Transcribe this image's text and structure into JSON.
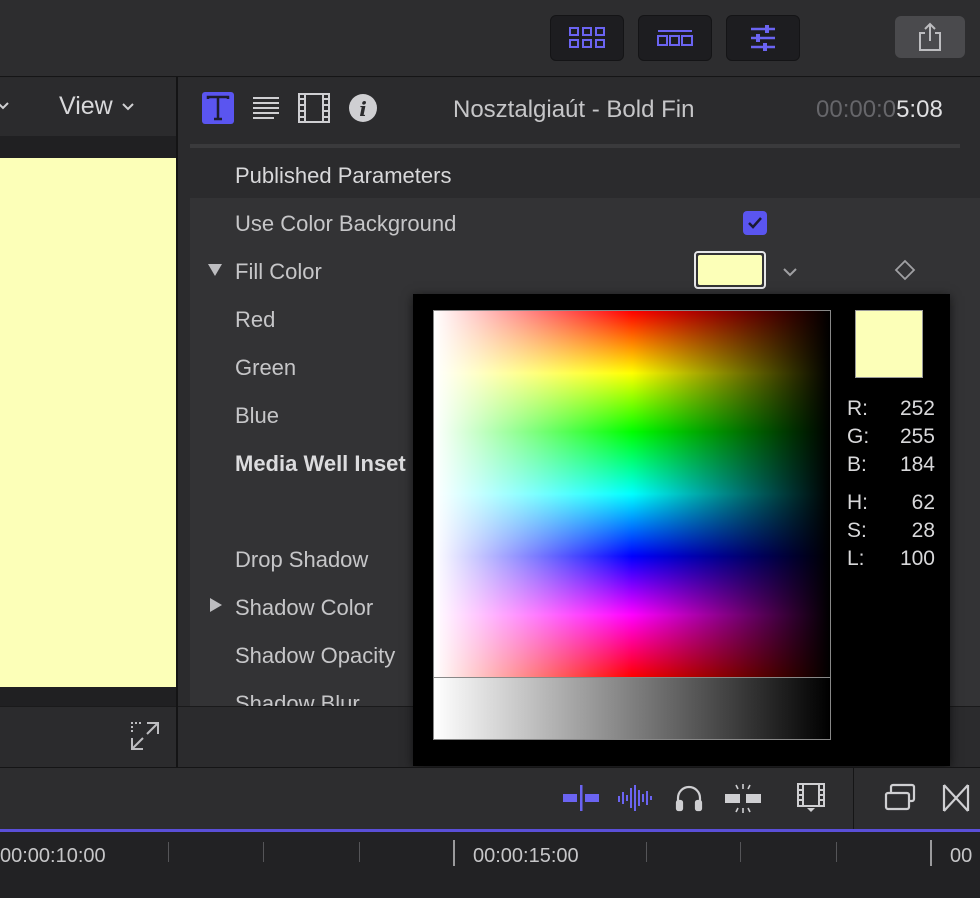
{
  "toolbar": {
    "buttons": [
      {
        "icon": "browser-grid-icon",
        "active": false
      },
      {
        "icon": "timeline-icon",
        "active": false
      },
      {
        "icon": "inspector-sliders-icon",
        "active": true
      }
    ],
    "share_icon": "share-icon"
  },
  "viewer": {
    "view_label": "View",
    "image_color": "#fcffb8"
  },
  "inspector": {
    "tabs": [
      "title-icon",
      "text-icon",
      "video-icon",
      "info-icon"
    ],
    "title": "Nosztalgiaút - Bold Fin",
    "timecode_dim": "00:00:0",
    "timecode_bright": "5:08",
    "section_header": "Published Parameters",
    "params": [
      {
        "label": "Use Color Background",
        "type": "checkbox",
        "checked": true
      },
      {
        "label": "Fill Color",
        "type": "color",
        "disclosure": "open",
        "color": "#fcffb8"
      },
      {
        "label": "Red",
        "type": "sub"
      },
      {
        "label": "Green",
        "type": "sub"
      },
      {
        "label": "Blue",
        "type": "sub"
      },
      {
        "label": "Media Well Inset",
        "type": "bold"
      },
      {
        "label": "Drop Shadow",
        "type": "plain"
      },
      {
        "label": "Shadow Color",
        "type": "color",
        "disclosure": "closed"
      },
      {
        "label": "Shadow Opacity",
        "type": "plain"
      },
      {
        "label": "Shadow Blur",
        "type": "plain"
      }
    ]
  },
  "color_picker": {
    "swatch_color": "#fcffb8",
    "rgb": [
      {
        "label": "R:",
        "value": "252"
      },
      {
        "label": "G:",
        "value": "255"
      },
      {
        "label": "B:",
        "value": "184"
      }
    ],
    "hsl": [
      {
        "label": "H:",
        "value": "62"
      },
      {
        "label": "S:",
        "value": "28"
      },
      {
        "label": "L:",
        "value": "100"
      }
    ]
  },
  "bottom_toolbar": {
    "icons": [
      "snapping-icon",
      "audio-skimming-icon",
      "headphones-icon",
      "solo-icon",
      "clip-appearance-icon",
      "effects-browser-icon",
      "transitions-icon"
    ]
  },
  "ruler": {
    "labels": [
      "00:00:10:00",
      "00:00:15:00",
      "00"
    ]
  },
  "colors": {
    "accent": "#5a55f0",
    "panel": "#2b2b2d"
  }
}
